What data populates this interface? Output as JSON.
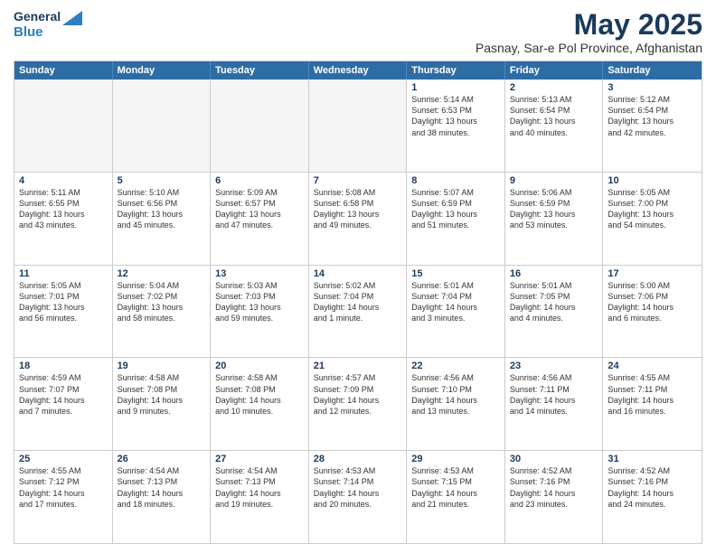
{
  "logo": {
    "line1": "General",
    "line2": "Blue"
  },
  "title": "May 2025",
  "location": "Pasnay, Sar-e Pol Province, Afghanistan",
  "days_of_week": [
    "Sunday",
    "Monday",
    "Tuesday",
    "Wednesday",
    "Thursday",
    "Friday",
    "Saturday"
  ],
  "weeks": [
    [
      {
        "num": "",
        "info": "",
        "empty": true
      },
      {
        "num": "",
        "info": "",
        "empty": true
      },
      {
        "num": "",
        "info": "",
        "empty": true
      },
      {
        "num": "",
        "info": "",
        "empty": true
      },
      {
        "num": "1",
        "info": "Sunrise: 5:14 AM\nSunset: 6:53 PM\nDaylight: 13 hours\nand 38 minutes.",
        "empty": false
      },
      {
        "num": "2",
        "info": "Sunrise: 5:13 AM\nSunset: 6:54 PM\nDaylight: 13 hours\nand 40 minutes.",
        "empty": false
      },
      {
        "num": "3",
        "info": "Sunrise: 5:12 AM\nSunset: 6:54 PM\nDaylight: 13 hours\nand 42 minutes.",
        "empty": false
      }
    ],
    [
      {
        "num": "4",
        "info": "Sunrise: 5:11 AM\nSunset: 6:55 PM\nDaylight: 13 hours\nand 43 minutes.",
        "empty": false
      },
      {
        "num": "5",
        "info": "Sunrise: 5:10 AM\nSunset: 6:56 PM\nDaylight: 13 hours\nand 45 minutes.",
        "empty": false
      },
      {
        "num": "6",
        "info": "Sunrise: 5:09 AM\nSunset: 6:57 PM\nDaylight: 13 hours\nand 47 minutes.",
        "empty": false
      },
      {
        "num": "7",
        "info": "Sunrise: 5:08 AM\nSunset: 6:58 PM\nDaylight: 13 hours\nand 49 minutes.",
        "empty": false
      },
      {
        "num": "8",
        "info": "Sunrise: 5:07 AM\nSunset: 6:59 PM\nDaylight: 13 hours\nand 51 minutes.",
        "empty": false
      },
      {
        "num": "9",
        "info": "Sunrise: 5:06 AM\nSunset: 6:59 PM\nDaylight: 13 hours\nand 53 minutes.",
        "empty": false
      },
      {
        "num": "10",
        "info": "Sunrise: 5:05 AM\nSunset: 7:00 PM\nDaylight: 13 hours\nand 54 minutes.",
        "empty": false
      }
    ],
    [
      {
        "num": "11",
        "info": "Sunrise: 5:05 AM\nSunset: 7:01 PM\nDaylight: 13 hours\nand 56 minutes.",
        "empty": false
      },
      {
        "num": "12",
        "info": "Sunrise: 5:04 AM\nSunset: 7:02 PM\nDaylight: 13 hours\nand 58 minutes.",
        "empty": false
      },
      {
        "num": "13",
        "info": "Sunrise: 5:03 AM\nSunset: 7:03 PM\nDaylight: 13 hours\nand 59 minutes.",
        "empty": false
      },
      {
        "num": "14",
        "info": "Sunrise: 5:02 AM\nSunset: 7:04 PM\nDaylight: 14 hours\nand 1 minute.",
        "empty": false
      },
      {
        "num": "15",
        "info": "Sunrise: 5:01 AM\nSunset: 7:04 PM\nDaylight: 14 hours\nand 3 minutes.",
        "empty": false
      },
      {
        "num": "16",
        "info": "Sunrise: 5:01 AM\nSunset: 7:05 PM\nDaylight: 14 hours\nand 4 minutes.",
        "empty": false
      },
      {
        "num": "17",
        "info": "Sunrise: 5:00 AM\nSunset: 7:06 PM\nDaylight: 14 hours\nand 6 minutes.",
        "empty": false
      }
    ],
    [
      {
        "num": "18",
        "info": "Sunrise: 4:59 AM\nSunset: 7:07 PM\nDaylight: 14 hours\nand 7 minutes.",
        "empty": false
      },
      {
        "num": "19",
        "info": "Sunrise: 4:58 AM\nSunset: 7:08 PM\nDaylight: 14 hours\nand 9 minutes.",
        "empty": false
      },
      {
        "num": "20",
        "info": "Sunrise: 4:58 AM\nSunset: 7:08 PM\nDaylight: 14 hours\nand 10 minutes.",
        "empty": false
      },
      {
        "num": "21",
        "info": "Sunrise: 4:57 AM\nSunset: 7:09 PM\nDaylight: 14 hours\nand 12 minutes.",
        "empty": false
      },
      {
        "num": "22",
        "info": "Sunrise: 4:56 AM\nSunset: 7:10 PM\nDaylight: 14 hours\nand 13 minutes.",
        "empty": false
      },
      {
        "num": "23",
        "info": "Sunrise: 4:56 AM\nSunset: 7:11 PM\nDaylight: 14 hours\nand 14 minutes.",
        "empty": false
      },
      {
        "num": "24",
        "info": "Sunrise: 4:55 AM\nSunset: 7:11 PM\nDaylight: 14 hours\nand 16 minutes.",
        "empty": false
      }
    ],
    [
      {
        "num": "25",
        "info": "Sunrise: 4:55 AM\nSunset: 7:12 PM\nDaylight: 14 hours\nand 17 minutes.",
        "empty": false
      },
      {
        "num": "26",
        "info": "Sunrise: 4:54 AM\nSunset: 7:13 PM\nDaylight: 14 hours\nand 18 minutes.",
        "empty": false
      },
      {
        "num": "27",
        "info": "Sunrise: 4:54 AM\nSunset: 7:13 PM\nDaylight: 14 hours\nand 19 minutes.",
        "empty": false
      },
      {
        "num": "28",
        "info": "Sunrise: 4:53 AM\nSunset: 7:14 PM\nDaylight: 14 hours\nand 20 minutes.",
        "empty": false
      },
      {
        "num": "29",
        "info": "Sunrise: 4:53 AM\nSunset: 7:15 PM\nDaylight: 14 hours\nand 21 minutes.",
        "empty": false
      },
      {
        "num": "30",
        "info": "Sunrise: 4:52 AM\nSunset: 7:16 PM\nDaylight: 14 hours\nand 23 minutes.",
        "empty": false
      },
      {
        "num": "31",
        "info": "Sunrise: 4:52 AM\nSunset: 7:16 PM\nDaylight: 14 hours\nand 24 minutes.",
        "empty": false
      }
    ]
  ]
}
